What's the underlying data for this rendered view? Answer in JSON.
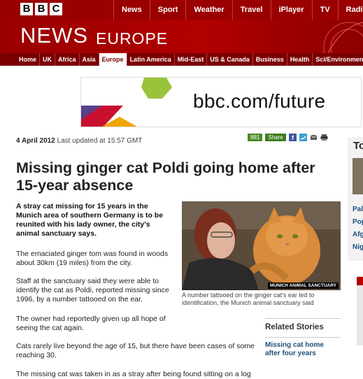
{
  "brand": {
    "letters": [
      "B",
      "B",
      "C"
    ]
  },
  "topnav": [
    "News",
    "Sport",
    "Weather",
    "Travel",
    "iPlayer",
    "TV",
    "Radio"
  ],
  "masthead": {
    "title": "NEWS",
    "section": "EUROPE"
  },
  "secnav": {
    "items": [
      "Home",
      "UK",
      "Africa",
      "Asia",
      "Europe",
      "Latin America",
      "Mid-East",
      "US & Canada",
      "Business",
      "Health",
      "Sci/Environment"
    ],
    "active": "Europe"
  },
  "banner": {
    "text": "bbc.com/future"
  },
  "article": {
    "date": "4 April 2012",
    "updated": "Last updated at 15:57 GMT",
    "title": "Missing ginger cat Poldi going home after 15-year absence",
    "intro": "A stray cat missing for 15 years in the Munich area of southern Germany is to be reunited with his lady owner, the city's animal sanctuary says.",
    "paragraphs": [
      "The emaciated ginger tom was found in woods about 30km (19 miles) from the city.",
      "Staff at the sanctuary said they were able to identify the cat as Poldi, reported missing since 1996, by a number tattooed on the ear.",
      "The owner had reportedly given up all hope of seeing the cat again.",
      "Cats rarely live beyond the age of 15, but there have been cases of some reaching 30.",
      "The missing cat was taken in as a stray after being found sitting on a log"
    ]
  },
  "share": {
    "count": "881",
    "label": "Share"
  },
  "photo": {
    "credit": "MUNICH ANIMAL SANCTUARY",
    "caption": "A number tattooed on the ginger cat's ear led to identification, the Munich animal sanctuary said"
  },
  "related": {
    "heading": "Related Stories",
    "links": [
      "Missing cat home after four years"
    ]
  },
  "sidebar": {
    "title": "To",
    "links": [
      "Pal",
      "Pop",
      "Afg",
      "Nig"
    ]
  }
}
